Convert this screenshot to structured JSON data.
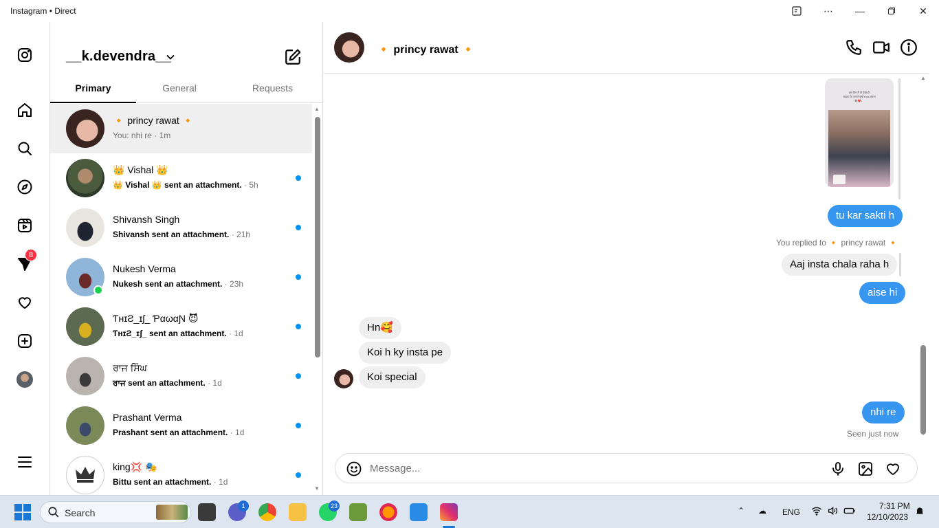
{
  "window": {
    "title": "Instagram • Direct"
  },
  "rail": {
    "badge_count": "8"
  },
  "sidebar": {
    "account_name": "__k.devendra__",
    "tabs": [
      "Primary",
      "General",
      "Requests"
    ]
  },
  "conversations": [
    {
      "name": "🔸 princy rawat 🔸",
      "preview": "You: nhi re",
      "time": " · 1m",
      "unread": false,
      "bold": false
    },
    {
      "name": "👑 Vishal 👑",
      "preview": "👑 Vishal 👑  sent an attachment.",
      "time": " · 5h",
      "unread": true,
      "bold": true
    },
    {
      "name": "Shivansh Singh",
      "preview": "Shivansh sent an attachment.",
      "time": " · 21h",
      "unread": true,
      "bold": true
    },
    {
      "name": "Nukesh Verma",
      "preview": "Nukesh sent an attachment.",
      "time": " · 23h",
      "unread": true,
      "bold": true
    },
    {
      "name": "ƬʜɪƧ_ɪʃ_ ƤαωαƝ 😈",
      "preview": "ƬʜɪƧ_ɪʃ_ sent an attachment.",
      "time": " · 1d",
      "unread": true,
      "bold": true
    },
    {
      "name": "ਰਾਜ ਸਿੰਘ",
      "preview": "ਰਾਜ sent an attachment.",
      "time": " · 1d",
      "unread": true,
      "bold": true
    },
    {
      "name": "Prashant Verma",
      "preview": "Prashant sent an attachment.",
      "time": " · 1d",
      "unread": true,
      "bold": true
    },
    {
      "name": "king💢 🎭",
      "preview": "Bittu sent an attachment.",
      "time": " · 1d",
      "unread": true,
      "bold": true
    }
  ],
  "chat": {
    "contact_name": "🔸 princy rawat 🔸",
    "messages": {
      "m1": "tu kar sakti h",
      "reply_label": "You replied to  🔸 princy rawat 🔸",
      "replied_text": "Aaj insta chala raha h",
      "m2": "aise hi",
      "m3": "Hn🥰",
      "m4": "Koi h ky insta pe",
      "m5": "Koi special",
      "m6": "nhi re",
      "seen": "Seen just now"
    },
    "thumbnail_text": "इस दिन मैं तो देखे ही\nचाहता के जानते तुम्हें Kiss करना\n😂❤️♩"
  },
  "composer": {
    "placeholder": "Message..."
  },
  "taskbar": {
    "search_label": "Search",
    "teams_badge": "1",
    "whatsapp_badge": "23",
    "lang": "ENG",
    "time": "7:31 PM",
    "date": "12/10/2023"
  },
  "colors": {
    "accent": "#3797f0",
    "unread_dot": "#0095f6",
    "badge": "#ff3040"
  }
}
